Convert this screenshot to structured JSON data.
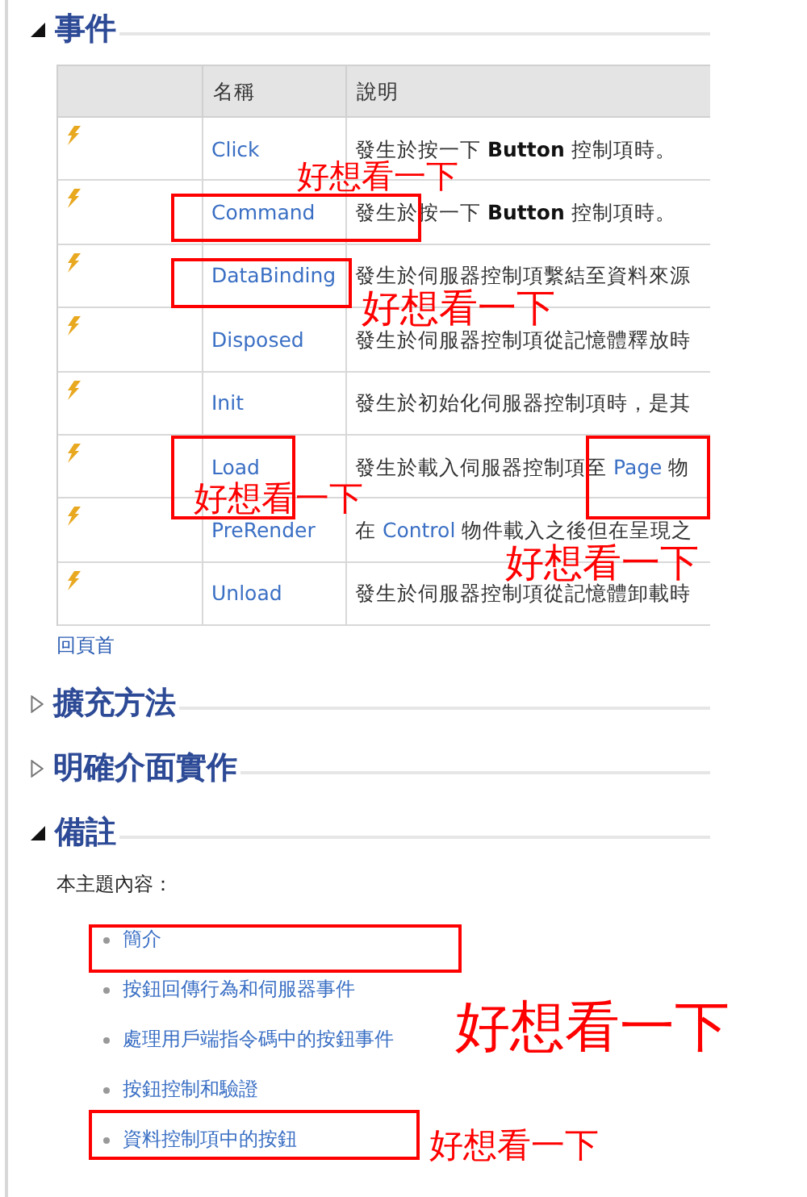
{
  "events": {
    "title": "事件",
    "expanded": true,
    "columns": [
      "名稱",
      "說明"
    ],
    "rows": [
      {
        "name": "Click",
        "description": [
          {
            "kind": "text",
            "text": "發生於按一下 "
          },
          {
            "kind": "bold",
            "text": "Button"
          },
          {
            "kind": "text",
            "text": " 控制項時。"
          }
        ]
      },
      {
        "name": "Command",
        "description": [
          {
            "kind": "text",
            "text": "發生於按一下 "
          },
          {
            "kind": "bold",
            "text": "Button"
          },
          {
            "kind": "text",
            "text": " 控制項時。"
          }
        ]
      },
      {
        "name": "DataBinding",
        "description": [
          {
            "kind": "text",
            "text": "發生於伺服器控制項繫結至資料來源"
          }
        ]
      },
      {
        "name": "Disposed",
        "description": [
          {
            "kind": "text",
            "text": "發生於伺服器控制項從記憶體釋放時"
          }
        ]
      },
      {
        "name": "Init",
        "description": [
          {
            "kind": "text",
            "text": "發生於初始化伺服器控制項時，是其"
          }
        ]
      },
      {
        "name": "Load",
        "description": [
          {
            "kind": "text",
            "text": "發生於載入伺服器控制項至 "
          },
          {
            "kind": "link",
            "text": "Page"
          },
          {
            "kind": "text",
            "text": " 物"
          }
        ]
      },
      {
        "name": "PreRender",
        "description": [
          {
            "kind": "text",
            "text": "在 "
          },
          {
            "kind": "link",
            "text": "Control"
          },
          {
            "kind": "text",
            "text": " 物件載入之後但在呈現之"
          }
        ]
      },
      {
        "name": "Unload",
        "description": [
          {
            "kind": "text",
            "text": "發生於伺服器控制項從記憶體卸載時"
          }
        ]
      }
    ],
    "back_to_top": "回頁首"
  },
  "sections": [
    {
      "title": "擴充方法",
      "expanded": false
    },
    {
      "title": "明確介面實作",
      "expanded": false
    }
  ],
  "remarks": {
    "title": "備註",
    "expanded": true,
    "intro": "本主題內容：",
    "links": [
      "簡介",
      "按鈕回傳行為和伺服器事件",
      "處理用戶端指令碼中的按鈕事件",
      "按鈕控制和驗證",
      "資料控制項中的按鈕"
    ]
  },
  "annotations": [
    "好想看一下",
    "好想看一下",
    "好想看一下",
    "好想看一下",
    "好想看一下",
    "好想看一下"
  ]
}
